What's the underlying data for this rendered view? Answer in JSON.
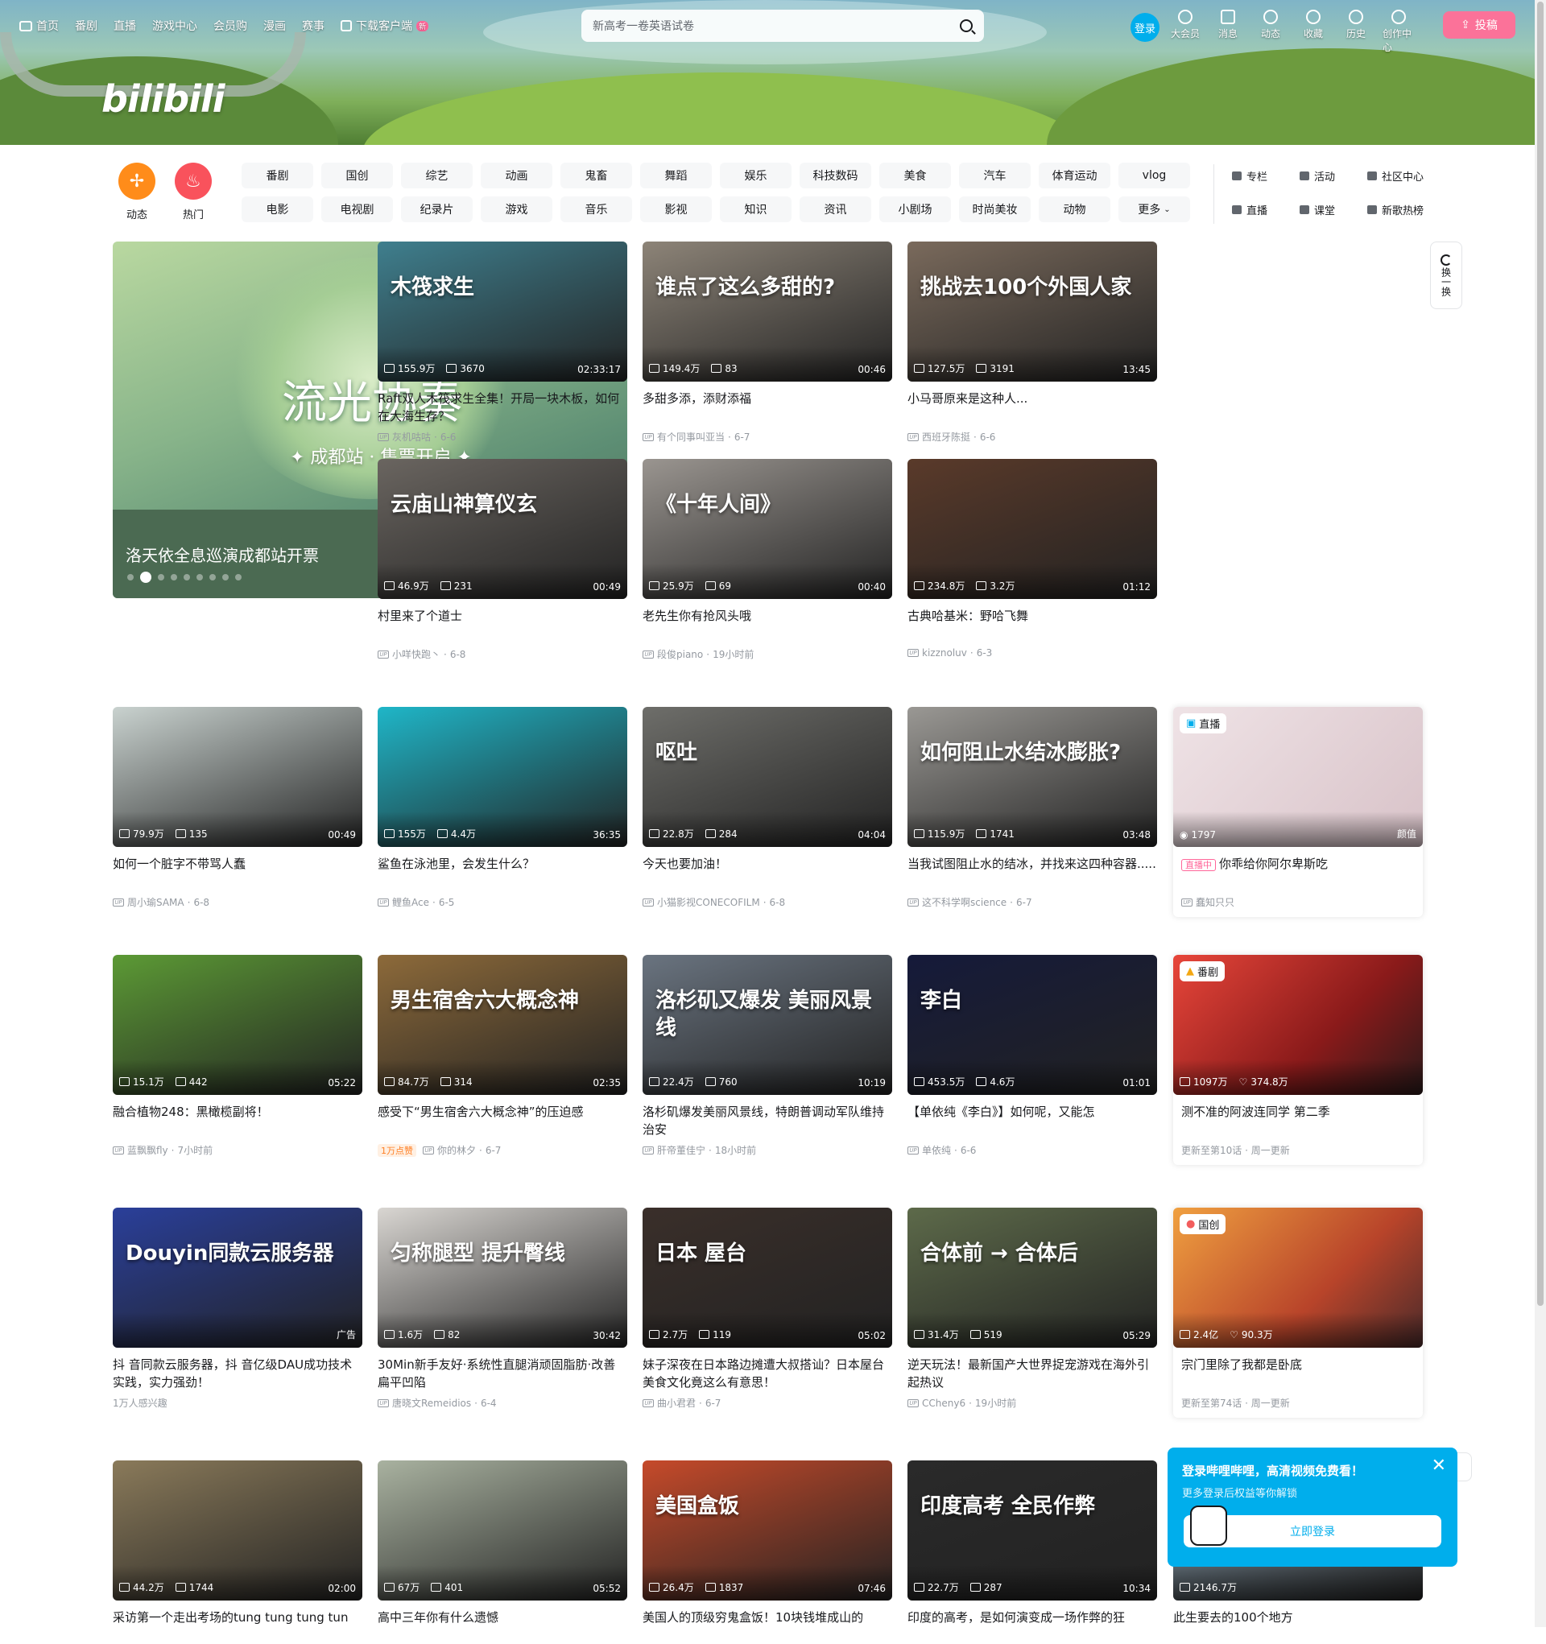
{
  "topnav": {
    "items": [
      "首页",
      "番剧",
      "直播",
      "游戏中心",
      "会员购",
      "漫画",
      "赛事",
      "下载客户端"
    ],
    "new_badge": "新"
  },
  "logo": "bilibili",
  "search": {
    "placeholder": "新高考一卷英语试卷"
  },
  "user": {
    "login": "登录",
    "icons": [
      "大会员",
      "消息",
      "动态",
      "收藏",
      "历史",
      "创作中心"
    ],
    "upload": "投稿"
  },
  "channels": {
    "big": [
      {
        "label": "动态",
        "color": "#ff8c1a"
      },
      {
        "label": "热门",
        "color": "#f9525c"
      }
    ],
    "grid": [
      "番剧",
      "国创",
      "综艺",
      "动画",
      "鬼畜",
      "舞蹈",
      "娱乐",
      "科技数码",
      "美食",
      "汽车",
      "体育运动",
      "vlog",
      "电影",
      "电视剧",
      "纪录片",
      "游戏",
      "音乐",
      "影视",
      "知识",
      "资讯",
      "小剧场",
      "时尚美妆",
      "动物",
      "更多"
    ],
    "side": [
      "专栏",
      "活动",
      "社区中心",
      "直播",
      "课堂",
      "新歌热榜"
    ]
  },
  "carousel": {
    "title_art": "流光协奏",
    "subtitle_art": "✦ 成都站 · 售票开启 ✦",
    "caption": "洛天依全息巡演成都站开票",
    "prev": "‹",
    "next": "›"
  },
  "refresh": {
    "label": "换一换"
  },
  "videos": [
    {
      "title": "Raft双人木筏求生全集！开局一块木板，如何在大海生存？",
      "up": "灰机咕咕",
      "date": "6-6",
      "views": "155.9万",
      "danmaku": "3670",
      "duration": "02:33:17",
      "overlay": "木筏求生",
      "color": "#3f7f8e"
    },
    {
      "title": "多甜多添，添财添福",
      "up": "有个同事叫亚当",
      "date": "6-7",
      "views": "149.4万",
      "danmaku": "83",
      "duration": "00:46",
      "overlay": "谁点了这么多甜的?",
      "color": "#8d8478"
    },
    {
      "title": "小马哥原来是这种人...",
      "up": "西班牙陈挺",
      "date": "6-6",
      "views": "127.5万",
      "danmaku": "3191",
      "duration": "13:45",
      "overlay": "挑战去100个外国人家",
      "color": "#7a6a5c"
    },
    {
      "title": "村里来了个道士",
      "up": "小咩快跑丶",
      "date": "6-8",
      "views": "46.9万",
      "danmaku": "231",
      "duration": "00:49",
      "overlay": "云庙山神算仪玄",
      "color": "#6a6560"
    },
    {
      "title": "老先生你有抢风头哦",
      "up": "段俊piano",
      "date": "19小时前",
      "views": "25.9万",
      "danmaku": "69",
      "duration": "00:40",
      "overlay": "《十年人间》",
      "color": "#9a9590"
    },
    {
      "title": "古典哈基米：野哈飞舞",
      "up": "kizznoluv",
      "date": "6-3",
      "views": "234.8万",
      "danmaku": "3.2万",
      "duration": "01:12",
      "overlay": "",
      "color": "#5a3a2a"
    },
    {
      "title": "如何一个脏字不带骂人蠢",
      "up": "周小瑜SAMA",
      "date": "6-8",
      "views": "79.9万",
      "danmaku": "135",
      "duration": "00:49",
      "overlay": "",
      "color": "#c9d2cf"
    },
    {
      "title": "鲨鱼在泳池里，会发生什么？",
      "up": "鲤鱼Ace",
      "date": "6-5",
      "views": "155万",
      "danmaku": "4.4万",
      "duration": "36:35",
      "overlay": "",
      "color": "#1fb6c8"
    },
    {
      "title": "今天也要加油！",
      "up": "小猫影视CONECOFILM",
      "date": "6-8",
      "views": "22.8万",
      "danmaku": "284",
      "duration": "04:04",
      "overlay": "呕吐",
      "color": "#6e6e6a"
    },
    {
      "title": "当我试图阻止水的结冰，并找来这四种容器.....",
      "up": "这不科学啊science",
      "date": "6-7",
      "views": "115.9万",
      "danmaku": "1741",
      "duration": "03:48",
      "overlay": "如何阻止水结冰膨胀?",
      "color": "#9a9894"
    },
    {
      "title": "融合植物248：黑橄榄副将！",
      "up": "蓝飘飘fly",
      "date": "7小时前",
      "views": "15.1万",
      "danmaku": "442",
      "duration": "05:22",
      "overlay": "",
      "color": "#5c9a35"
    },
    {
      "title": "感受下“男生宿舍六大概念神”的压迫感",
      "up": "你的林夕",
      "date": "6-7",
      "views": "84.7万",
      "danmaku": "314",
      "duration": "02:35",
      "overlay": "男生宿舍六大概念神",
      "color": "#8d6a3a",
      "hot": "1万点赞"
    },
    {
      "title": "洛杉矶爆发美丽风景线，特朗普调动军队维持治安",
      "up": "肝帝董佳宁",
      "date": "18小时前",
      "views": "22.4万",
      "danmaku": "760",
      "duration": "10:19",
      "overlay": "洛杉矶又爆发 美丽风景线",
      "color": "#6a7480"
    },
    {
      "title": "【单依纯《李白》】如何呢，又能怎",
      "up": "单依纯",
      "date": "6-6",
      "views": "453.5万",
      "danmaku": "4.6万",
      "duration": "01:01",
      "overlay": "李白",
      "color": "#151a3a"
    },
    {
      "title": "抖 音同款云服务器，抖 音亿级DAU成功技术实践，实力强劲！",
      "up": "1万人感兴趣",
      "date": "",
      "views": "",
      "danmaku": "",
      "duration": "广告",
      "overlay": "Douyin同款云服务器",
      "color": "#2a3f9a"
    },
    {
      "title": "30Min新手友好·系统性直腿消顽固脂肪·改善扁平凹陷",
      "up": "唐晓文Remeidios",
      "date": "6-4",
      "views": "1.6万",
      "danmaku": "82",
      "duration": "30:42",
      "overlay": "匀称腿型 提升臀线",
      "color": "#d9d6d2"
    },
    {
      "title": "妹子深夜在日本路边摊遭大叔搭讪？日本屋台美食文化竟这么有意思！",
      "up": "曲小君君",
      "date": "6-7",
      "views": "2.7万",
      "danmaku": "119",
      "duration": "05:02",
      "overlay": "日本 屋台",
      "color": "#3a2f2a"
    },
    {
      "title": "逆天玩法！最新国产大世界捉宠游戏在海外引起热议",
      "up": "CCheny6",
      "date": "19小时前",
      "views": "31.4万",
      "danmaku": "519",
      "duration": "05:29",
      "overlay": "合体前 → 合体后",
      "color": "#5d6a4a"
    },
    {
      "title": "采访第一个走出考场的tung tung tung tun",
      "up": "",
      "date": "",
      "views": "44.2万",
      "danmaku": "1744",
      "duration": "02:00",
      "overlay": "",
      "color": "#8a7a5a"
    },
    {
      "title": "高中三年你有什么遗憾",
      "up": "",
      "date": "",
      "views": "67万",
      "danmaku": "401",
      "duration": "05:52",
      "overlay": "",
      "color": "#a9b2a0"
    },
    {
      "title": "美国人的顶级穷鬼盒饭！10块钱堆成山的",
      "up": "",
      "date": "",
      "views": "26.4万",
      "danmaku": "1837",
      "duration": "07:46",
      "overlay": "美国盒饭",
      "color": "#c64a2a"
    },
    {
      "title": "印度的高考，是如何演变成一场作弊的狂",
      "up": "",
      "date": "",
      "views": "22.7万",
      "danmaku": "287",
      "duration": "10:34",
      "overlay": "印度高考 全民作弊",
      "color": "#2a2a2a"
    },
    {
      "title": "此生要去的100个地方",
      "up": "",
      "date": "",
      "views": "2146.7万",
      "danmaku": "",
      "duration": "",
      "overlay": "",
      "color": "#8aa0b0"
    }
  ],
  "special": {
    "live": {
      "tag": "直播",
      "views": "1797",
      "category": "颜值",
      "badge": "直播中",
      "title": "你乖给你阿尔卑斯吃",
      "up": "蠢知只只",
      "color": "#e8d4d8"
    },
    "bangumi": {
      "tag": "番剧",
      "views": "1097万",
      "likes": "374.8万",
      "title": "测不准的阿波连同学 第二季",
      "meta": "更新至第10话 · 周一更新",
      "color": "#c0302a"
    },
    "guochuang": {
      "tag": "国创",
      "views": "2.4亿",
      "likes": "90.3万",
      "title": "宗门里除了我都是卧底",
      "meta": "更新至第74话 · 周一更新",
      "color": "#b8642a"
    }
  },
  "loginpop": {
    "title": "登录哔哩哔哩，高清视频免费看！",
    "sub": "更多登录后权益等你解锁",
    "button": "立即登录",
    "close": "✕"
  }
}
